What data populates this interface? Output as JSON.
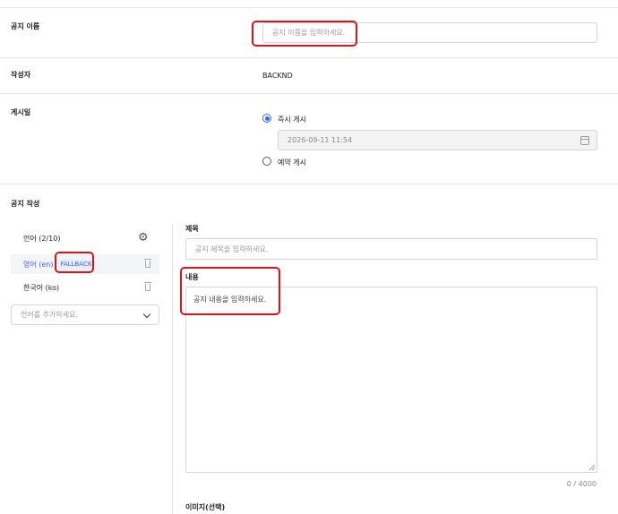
{
  "notice_name": {
    "label": "공지 이름",
    "placeholder": "공지 이름을 입력하세요."
  },
  "author": {
    "label": "작성자",
    "value": "BACKND"
  },
  "post_date": {
    "label": "게시일",
    "immediate_label": "즉시 게시",
    "datetime_value": "2026-09-11 11:54",
    "scheduled_label": "예약 게시",
    "selected": "immediate"
  },
  "compose": {
    "label": "공지 작성",
    "language_header": "언어 (2/10)",
    "languages": [
      {
        "label": "영어 (en)",
        "badge": "FALLBACK",
        "active": true
      },
      {
        "label": "한국어 (ko)",
        "badge": "",
        "active": false
      }
    ],
    "add_language_placeholder": "언어를 추가하세요.",
    "title_label": "제목",
    "title_placeholder": "공지 제목을 입력하세요.",
    "content_label": "내용",
    "content_placeholder": "공지 내용을 입력하세요.",
    "char_count": "0 / 4000",
    "image_label": "이미지(선택)"
  },
  "icons": {
    "settings": "gear-icon",
    "delete": "trash-icon",
    "calendar": "calendar-icon",
    "dropdown": "chevron-down-icon"
  },
  "colors": {
    "accent": "#3a64f0",
    "highlight": "#e0111b",
    "badge_bg": "#e8eefc"
  }
}
